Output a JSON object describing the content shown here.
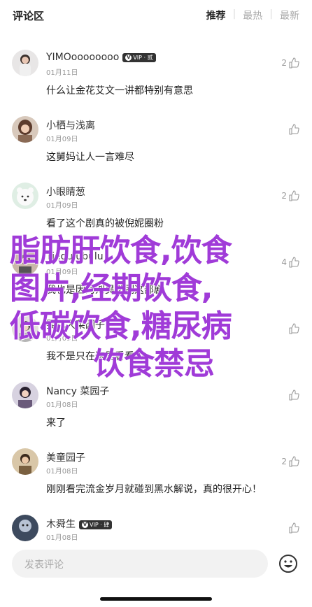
{
  "header": {
    "title": "评论区",
    "tabs": [
      {
        "label": "推荐",
        "active": true
      },
      {
        "label": "最热",
        "active": false
      },
      {
        "label": "最新",
        "active": false
      }
    ]
  },
  "comments": [
    {
      "name": "YIMOoooooooo",
      "vip": "VIP · 贰",
      "date": "01月11日",
      "text": "什么让金花艾文一讲都特别有意思",
      "likes": "2"
    },
    {
      "name": "小栖与浅离",
      "vip": "",
      "date": "01月09日",
      "text": "这舅妈让人一言难尽",
      "likes": ""
    },
    {
      "name": "小眼睛葱",
      "vip": "",
      "date": "01月09日",
      "text": "看了这个剧真的被倪妮圈粉",
      "likes": "2"
    },
    {
      "name": "Tiegulubulu",
      "vip": "",
      "date": "01月09日",
      "text": "我也是因为刘昊然刷这部剧",
      "likes": "4"
    },
    {
      "name": "婴儿大菜园子",
      "vip": "",
      "date": "01月09日",
      "text": "我不是只在这里看看的",
      "likes": ""
    },
    {
      "name": "Nancy 菜园子",
      "vip": "",
      "date": "01月08日",
      "text": "来了",
      "likes": ""
    },
    {
      "name": "美童园子",
      "vip": "",
      "date": "01月08日",
      "text": "刚刚看完流金岁月就碰到黑水解说，真的很开心！",
      "likes": "2"
    },
    {
      "name": "木舜生",
      "vip": "VIP · 肆",
      "date": "01月08日",
      "text": "",
      "likes": ""
    }
  ],
  "watermark": {
    "line1": "脂肪肝饮食,饮食",
    "line2": "图片,经期饮食,",
    "line3": "低碳饮食,糖尿病",
    "line4": "饮食禁忌"
  },
  "input": {
    "placeholder": "发表评论"
  },
  "colors": {
    "watermark": "#a03bd8",
    "tab_active": "#222222",
    "tab_inactive": "#aaaaaa"
  }
}
